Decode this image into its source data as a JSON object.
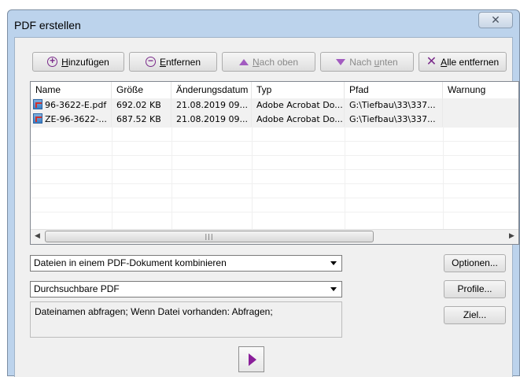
{
  "window": {
    "title": "PDF erstellen",
    "close_glyph": "✕"
  },
  "toolbar": {
    "add": {
      "label": "Hinzufügen",
      "mnemonic": "H",
      "rest": "inzufügen"
    },
    "remove": {
      "label": "Entfernen",
      "mnemonic": "E",
      "rest": "ntfernen"
    },
    "move_up": {
      "label": "Nach oben",
      "prefix": "",
      "mnemonic": "N",
      "rest": "ach oben"
    },
    "move_down": {
      "label": "Nach unten",
      "prefix": "Nach ",
      "mnemonic": "u",
      "rest": "nten"
    },
    "remove_all": {
      "label": "Alle entfernen",
      "mnemonic": "A",
      "rest": "lle entfernen"
    }
  },
  "file_list": {
    "columns": [
      "Name",
      "Größe",
      "Änderungsdatum",
      "Typ",
      "Pfad",
      "Warnung"
    ],
    "rows": [
      {
        "name": "96-3622-E.pdf",
        "size": "692.02 KB",
        "modified": "21.08.2019 09...",
        "type": "Adobe Acrobat Do...",
        "path": "G:\\Tiefbau\\33\\337...",
        "warning": ""
      },
      {
        "name": "ZE-96-3622-...",
        "size": "687.52 KB",
        "modified": "21.08.2019 09...",
        "type": "Adobe Acrobat Do...",
        "path": "G:\\Tiefbau\\33\\337...",
        "warning": ""
      }
    ],
    "scroll_grip": "|||"
  },
  "combine_select": {
    "value": "Dateien in einem PDF-Dokument kombinieren"
  },
  "profile_select": {
    "value": "Durchsuchbare PDF"
  },
  "status_text": "Dateinamen abfragen; Wenn Datei vorhanden: Abfragen;",
  "buttons": {
    "options": "Optionen...",
    "profiles": "Profile...",
    "target": "Ziel..."
  },
  "colors": {
    "accent": "#8a1f9a",
    "frame": "#bcd3ec"
  }
}
